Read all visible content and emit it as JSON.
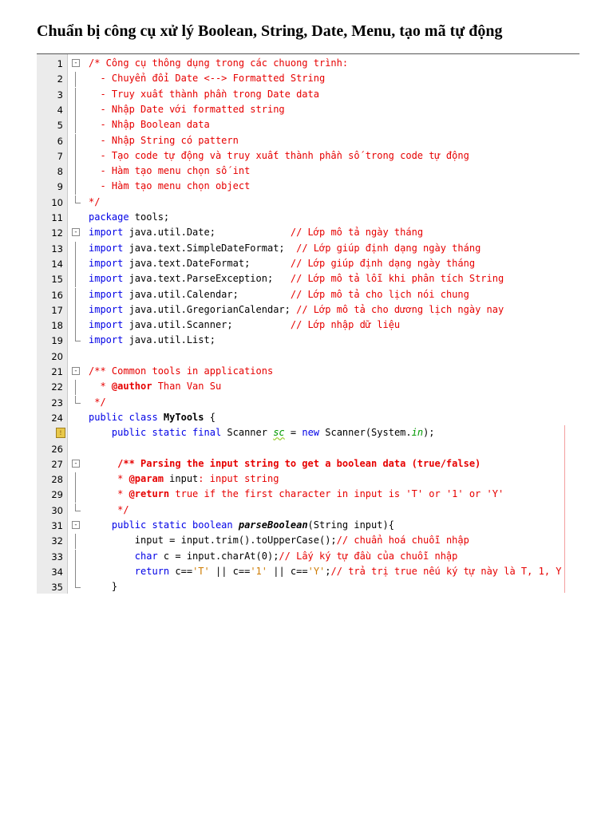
{
  "title": "Chuẩn bị công cụ xử lý Boolean, String, Date, Menu, tạo mã tự động",
  "lines": [
    {
      "n": "1",
      "fold": "open",
      "segs": [
        [
          "c",
          "/* Công cụ thông dụng trong các chuong trình:"
        ]
      ]
    },
    {
      "n": "2",
      "fold": "mid",
      "segs": [
        [
          "c",
          "  - Chuyển đổi Date <--> Formatted String"
        ]
      ]
    },
    {
      "n": "3",
      "fold": "mid",
      "segs": [
        [
          "c",
          "  - Truy xuất thành phần trong Date data"
        ]
      ]
    },
    {
      "n": "4",
      "fold": "mid",
      "segs": [
        [
          "c",
          "  - Nhập Date với formatted string"
        ]
      ]
    },
    {
      "n": "5",
      "fold": "mid",
      "segs": [
        [
          "c",
          "  - Nhập Boolean data"
        ]
      ]
    },
    {
      "n": "6",
      "fold": "mid",
      "segs": [
        [
          "c",
          "  - Nhập String có pattern"
        ]
      ]
    },
    {
      "n": "7",
      "fold": "mid",
      "segs": [
        [
          "c",
          "  - Tạo code tự động và truy xuất thành phần số trong code tự động"
        ]
      ]
    },
    {
      "n": "8",
      "fold": "mid",
      "segs": [
        [
          "c",
          "  - Hàm tạo menu chọn số int"
        ]
      ]
    },
    {
      "n": "9",
      "fold": "mid",
      "segs": [
        [
          "c",
          "  - Hàm tạo menu chọn object"
        ]
      ]
    },
    {
      "n": "10",
      "fold": "end",
      "segs": [
        [
          "c",
          "*/"
        ]
      ]
    },
    {
      "n": "11",
      "fold": "",
      "segs": [
        [
          "k",
          "package"
        ],
        [
          "p",
          " tools;"
        ]
      ]
    },
    {
      "n": "12",
      "fold": "open",
      "segs": [
        [
          "k",
          "import"
        ],
        [
          "p",
          " java.util.Date;             "
        ],
        [
          "c",
          "// Lớp mô tả ngày tháng"
        ]
      ]
    },
    {
      "n": "13",
      "fold": "mid",
      "segs": [
        [
          "k",
          "import"
        ],
        [
          "p",
          " java.text.SimpleDateFormat;  "
        ],
        [
          "c",
          "// Lớp giúp định dạng ngày tháng"
        ]
      ]
    },
    {
      "n": "14",
      "fold": "mid",
      "segs": [
        [
          "k",
          "import"
        ],
        [
          "p",
          " java.text.DateFormat;       "
        ],
        [
          "c",
          "// Lớp giúp định dạng ngày tháng"
        ]
      ]
    },
    {
      "n": "15",
      "fold": "mid",
      "segs": [
        [
          "k",
          "import"
        ],
        [
          "p",
          " java.text.ParseException;   "
        ],
        [
          "c",
          "// Lớp mô tả lỗi khi phân tích String"
        ]
      ]
    },
    {
      "n": "16",
      "fold": "mid",
      "segs": [
        [
          "k",
          "import"
        ],
        [
          "p",
          " java.util.Calendar;         "
        ],
        [
          "c",
          "// Lớp mô tả cho lịch nói chung"
        ]
      ]
    },
    {
      "n": "17",
      "fold": "mid",
      "segs": [
        [
          "k",
          "import"
        ],
        [
          "p",
          " java.util.GregorianCalendar; "
        ],
        [
          "c",
          "// Lớp mô tả cho dương lịch ngày nay"
        ]
      ]
    },
    {
      "n": "18",
      "fold": "mid",
      "segs": [
        [
          "k",
          "import"
        ],
        [
          "p",
          " java.util.Scanner;          "
        ],
        [
          "c",
          "// Lớp nhập dữ liệu"
        ]
      ]
    },
    {
      "n": "19",
      "fold": "end",
      "segs": [
        [
          "k",
          "import"
        ],
        [
          "p",
          " java.util.List;"
        ]
      ]
    },
    {
      "n": "20",
      "fold": "",
      "segs": []
    },
    {
      "n": "21",
      "fold": "open",
      "segs": [
        [
          "c",
          "/** Common tools in applications"
        ]
      ]
    },
    {
      "n": "22",
      "fold": "mid",
      "segs": [
        [
          "c",
          "  * "
        ],
        [
          "cb",
          "@author"
        ],
        [
          "c",
          " Than Van Su"
        ]
      ]
    },
    {
      "n": "23",
      "fold": "end",
      "segs": [
        [
          "c",
          " */"
        ]
      ]
    },
    {
      "n": "24",
      "fold": "",
      "segs": [
        [
          "k",
          "public class"
        ],
        [
          "p b",
          " MyTools"
        ],
        [
          "p",
          " {"
        ]
      ]
    },
    {
      "n": "",
      "warn": true,
      "fold": "",
      "segs": [
        [
          "k",
          "    public static final"
        ],
        [
          "p",
          " Scanner "
        ],
        [
          "g w",
          "sc"
        ],
        [
          "p",
          " = "
        ],
        [
          "k",
          "new"
        ],
        [
          "p",
          " Scanner(System."
        ],
        [
          "g",
          "in"
        ],
        [
          "p",
          ");"
        ]
      ]
    },
    {
      "n": "26",
      "fold": "",
      "segs": []
    },
    {
      "n": "27",
      "fold": "open",
      "segs": [
        [
          "cb",
          "     /** Parsing the input string to get a boolean data (true/false)"
        ]
      ]
    },
    {
      "n": "28",
      "fold": "mid",
      "segs": [
        [
          "c",
          "     * "
        ],
        [
          "cb",
          "@param"
        ],
        [
          "p",
          " input"
        ],
        [
          "c",
          ": input string"
        ]
      ]
    },
    {
      "n": "29",
      "fold": "mid",
      "segs": [
        [
          "c",
          "     * "
        ],
        [
          "cb",
          "@return"
        ],
        [
          "c",
          " true if the first character in input is 'T' or '1' or 'Y'"
        ]
      ]
    },
    {
      "n": "30",
      "fold": "end",
      "segs": [
        [
          "c",
          "     */"
        ]
      ]
    },
    {
      "n": "31",
      "fold": "open",
      "segs": [
        [
          "k",
          "    public static boolean"
        ],
        [
          "p i",
          " parseBoolean"
        ],
        [
          "p",
          "(String input){"
        ]
      ]
    },
    {
      "n": "32",
      "fold": "mid",
      "segs": [
        [
          "p",
          "        input = input.trim().toUpperCase();"
        ],
        [
          "c",
          "// chuẩn hoá chuỗi nhập"
        ]
      ]
    },
    {
      "n": "33",
      "fold": "mid",
      "segs": [
        [
          "k",
          "        char"
        ],
        [
          "p",
          " c = input.charAt(0);"
        ],
        [
          "c",
          "// Lấy ký tự đầu của chuỗi nhập"
        ]
      ]
    },
    {
      "n": "34",
      "fold": "mid",
      "segs": [
        [
          "k",
          "        return"
        ],
        [
          "p",
          " c=="
        ],
        [
          "s",
          "'T'"
        ],
        [
          "p",
          " || c=="
        ],
        [
          "s",
          "'1'"
        ],
        [
          "p",
          " || c=="
        ],
        [
          "s",
          "'Y'"
        ],
        [
          "p",
          ";"
        ],
        [
          "c",
          "// trả trị true nếu ký tự này là T, 1, Y"
        ]
      ]
    },
    {
      "n": "35",
      "fold": "end",
      "segs": [
        [
          "p",
          "    }"
        ]
      ]
    }
  ]
}
